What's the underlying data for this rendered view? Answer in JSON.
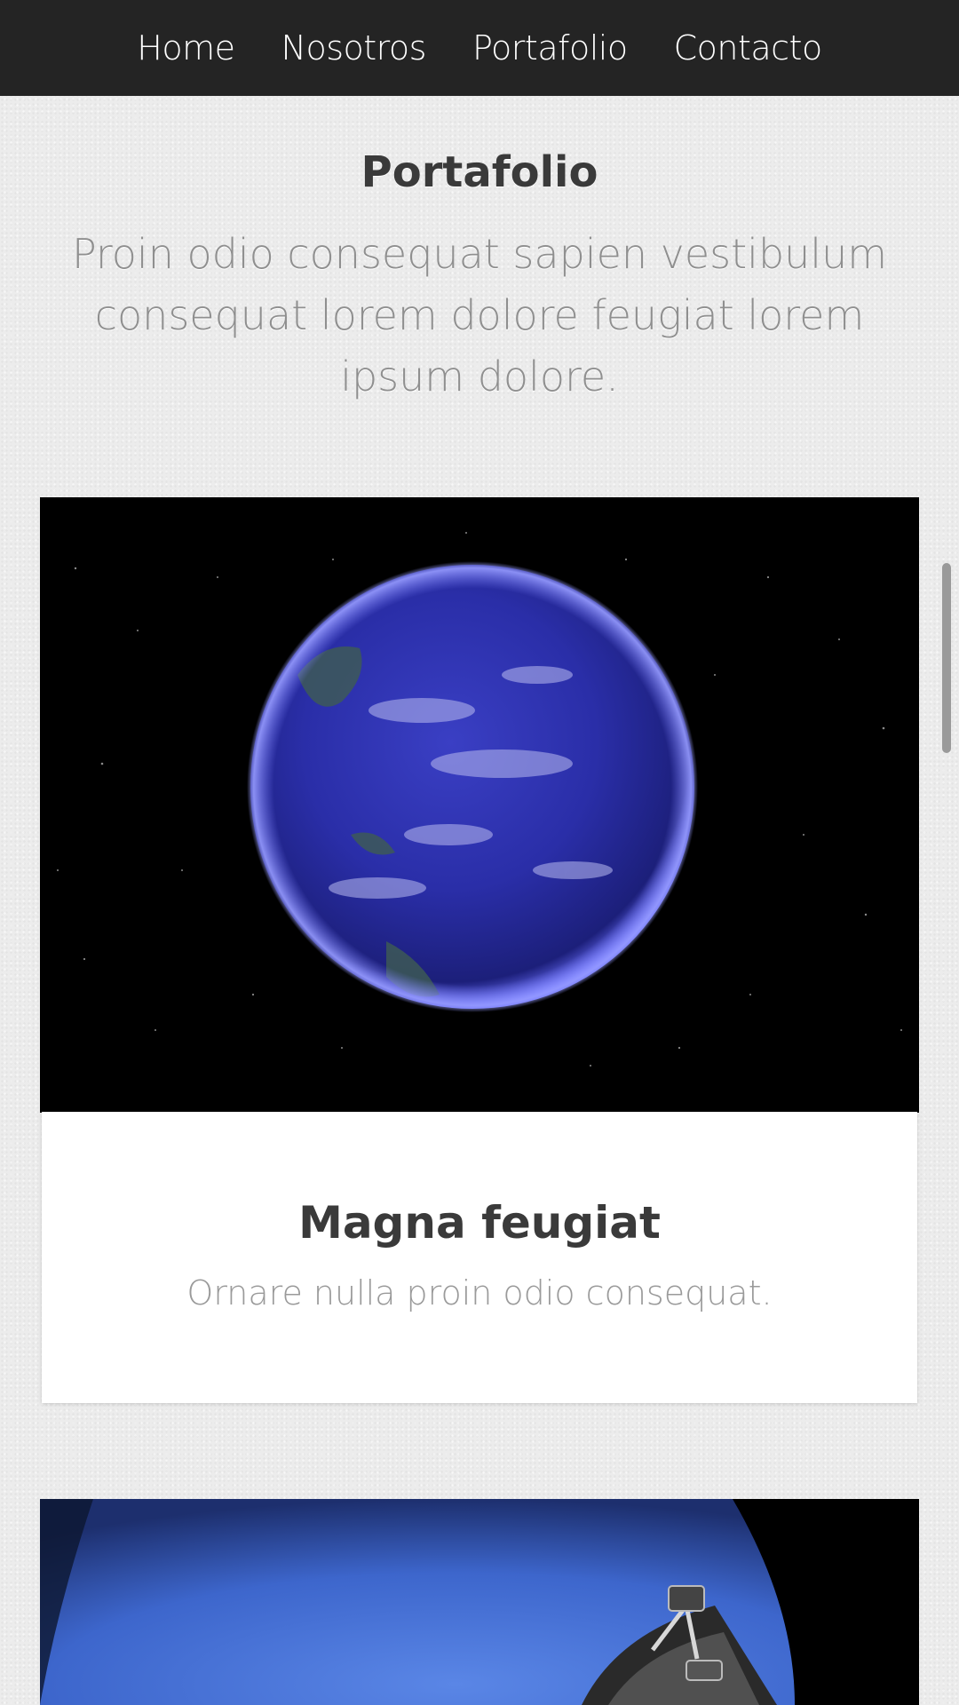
{
  "nav": {
    "items": [
      {
        "label": "Home"
      },
      {
        "label": "Nosotros"
      },
      {
        "label": "Portafolio"
      },
      {
        "label": "Contacto"
      }
    ]
  },
  "portfolio": {
    "title": "Portafolio",
    "subtitle": "Proin odio consequat sapien vestibulum consequat lorem dolore feugiat lorem ipsum dolore.",
    "items": [
      {
        "image": "earth-in-space",
        "title": "Magna feugiat",
        "description": "Ornare nulla proin odio consequat."
      },
      {
        "image": "satellite-dish-over-earth"
      }
    ]
  },
  "colors": {
    "nav_background": "#242424",
    "page_background": "#ececec",
    "heading": "#3a3a3a",
    "muted_text": "#8f8f8f",
    "card_background": "#ffffff"
  }
}
